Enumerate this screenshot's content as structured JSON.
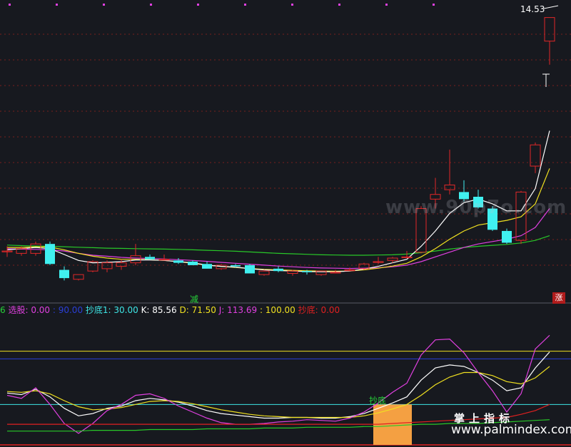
{
  "header": {
    "price_label": "14.53",
    "indicator_items": [
      {
        "text": "6",
        "color": "#27d23a"
      },
      {
        "text": " 选股: 0.00",
        "color": "#e040e0"
      },
      {
        "text": " : 90.00",
        "color": "#2a3fd8"
      },
      {
        "text": " 抄底1: 30.00",
        "color": "#3ee6e6"
      },
      {
        "text": " K: 85.56",
        "color": "#ffffff"
      },
      {
        "text": " D: 71.50",
        "color": "#f0e020"
      },
      {
        "text": " J: 113.69",
        "color": "#e040e0"
      },
      {
        "text": " : 100.00",
        "color": "#f0e020"
      },
      {
        "text": " 抄底: 0.00",
        "color": "#e02020"
      }
    ]
  },
  "annotations": {
    "sell_marker": "减",
    "limit_up_marker": "涨",
    "bottom_marker": "抄底"
  },
  "watermark": {
    "main": "www.90p7o.com",
    "cn": "掌上指标",
    "en": "www.palmindex.com"
  },
  "colors": {
    "background": "#17191f",
    "up_candle": "#e02828",
    "down_candle": "#40f0f0",
    "ma_white": "#ffffff",
    "ma_yellow": "#f0e020",
    "ma_magenta": "#e040e0",
    "ma_green": "#28c828",
    "grid": "#7a1e1e"
  },
  "chart_data": [
    {
      "type": "candlestick",
      "title": "",
      "ylim": [
        3.5,
        15.2
      ],
      "candles": [
        {
          "o": 5.1,
          "h": 5.3,
          "l": 4.85,
          "c": 5.1
        },
        {
          "o": 5.0,
          "h": 5.3,
          "l": 4.9,
          "c": 5.2
        },
        {
          "o": 5.0,
          "h": 5.5,
          "l": 4.9,
          "c": 5.4
        },
        {
          "o": 5.4,
          "h": 5.5,
          "l": 4.5,
          "c": 4.55
        },
        {
          "o": 4.3,
          "h": 4.45,
          "l": 3.85,
          "c": 3.95
        },
        {
          "o": 3.9,
          "h": 4.1,
          "l": 3.85,
          "c": 4.1
        },
        {
          "o": 4.25,
          "h": 4.7,
          "l": 4.2,
          "c": 4.65
        },
        {
          "o": 4.35,
          "h": 4.7,
          "l": 4.2,
          "c": 4.6
        },
        {
          "o": 4.45,
          "h": 4.75,
          "l": 4.3,
          "c": 4.6
        },
        {
          "o": 4.6,
          "h": 5.4,
          "l": 4.5,
          "c": 4.9
        },
        {
          "o": 4.85,
          "h": 4.95,
          "l": 4.75,
          "c": 4.75
        },
        {
          "o": 4.75,
          "h": 4.95,
          "l": 4.7,
          "c": 4.75
        },
        {
          "o": 4.7,
          "h": 4.8,
          "l": 4.55,
          "c": 4.6
        },
        {
          "o": 4.65,
          "h": 4.7,
          "l": 4.5,
          "c": 4.5
        },
        {
          "o": 4.55,
          "h": 4.65,
          "l": 4.35,
          "c": 4.35
        },
        {
          "o": 4.35,
          "h": 4.55,
          "l": 4.3,
          "c": 4.5
        },
        {
          "o": 4.5,
          "h": 4.55,
          "l": 4.4,
          "c": 4.45
        },
        {
          "o": 4.5,
          "h": 4.55,
          "l": 4.15,
          "c": 4.15
        },
        {
          "o": 4.1,
          "h": 4.3,
          "l": 4.05,
          "c": 4.25
        },
        {
          "o": 4.35,
          "h": 4.45,
          "l": 4.2,
          "c": 4.25
        },
        {
          "o": 4.15,
          "h": 4.3,
          "l": 4.05,
          "c": 4.25
        },
        {
          "o": 4.25,
          "h": 4.3,
          "l": 4.1,
          "c": 4.2
        },
        {
          "o": 4.1,
          "h": 4.25,
          "l": 4.05,
          "c": 4.25
        },
        {
          "o": 4.2,
          "h": 4.3,
          "l": 4.15,
          "c": 4.2
        },
        {
          "o": 4.3,
          "h": 4.4,
          "l": 4.25,
          "c": 4.3
        },
        {
          "o": 4.35,
          "h": 4.6,
          "l": 4.3,
          "c": 4.55
        },
        {
          "o": 4.65,
          "h": 4.85,
          "l": 4.55,
          "c": 4.65
        },
        {
          "o": 4.7,
          "h": 4.85,
          "l": 4.6,
          "c": 4.8
        },
        {
          "o": 4.85,
          "h": 5.1,
          "l": 4.8,
          "c": 4.85
        },
        {
          "o": 5.05,
          "h": 7.0,
          "l": 5.0,
          "c": 6.9
        },
        {
          "o": 7.3,
          "h": 8.2,
          "l": 6.9,
          "c": 7.5
        },
        {
          "o": 7.7,
          "h": 9.4,
          "l": 7.5,
          "c": 7.9
        },
        {
          "o": 7.6,
          "h": 8.1,
          "l": 7.2,
          "c": 7.3
        },
        {
          "o": 7.4,
          "h": 7.7,
          "l": 6.9,
          "c": 6.95
        },
        {
          "o": 6.9,
          "h": 7.0,
          "l": 5.95,
          "c": 6.0
        },
        {
          "o": 5.95,
          "h": 6.05,
          "l": 5.4,
          "c": 5.45
        },
        {
          "o": 5.55,
          "h": 7.65,
          "l": 5.4,
          "c": 7.6
        },
        {
          "o": 8.7,
          "h": 9.7,
          "l": 8.4,
          "c": 9.6
        },
        {
          "o": 14.0,
          "h": 15.0,
          "l": 13.0,
          "c": 15.0
        }
      ],
      "ma_white": [
        5.15,
        5.2,
        5.25,
        5.2,
        4.95,
        4.7,
        4.6,
        4.62,
        4.65,
        4.72,
        4.72,
        4.7,
        4.65,
        4.6,
        4.5,
        4.45,
        4.42,
        4.35,
        4.3,
        4.27,
        4.25,
        4.23,
        4.22,
        4.22,
        4.25,
        4.33,
        4.45,
        4.6,
        4.75,
        5.3,
        5.95,
        6.7,
        7.15,
        7.3,
        7.1,
        6.8,
        6.8,
        7.75,
        10.2
      ],
      "ma_yellow": [
        5.25,
        5.25,
        5.28,
        5.27,
        5.15,
        5.0,
        4.88,
        4.8,
        4.75,
        4.75,
        4.73,
        4.7,
        4.65,
        4.58,
        4.5,
        4.45,
        4.4,
        4.36,
        4.32,
        4.3,
        4.28,
        4.26,
        4.25,
        4.24,
        4.25,
        4.3,
        4.37,
        4.46,
        4.58,
        4.85,
        5.2,
        5.6,
        5.95,
        6.2,
        6.3,
        6.4,
        6.55,
        7.1,
        8.6
      ],
      "ma_magenta": [
        5.2,
        5.18,
        5.17,
        5.15,
        5.1,
        5.0,
        4.92,
        4.88,
        4.83,
        4.8,
        4.78,
        4.76,
        4.73,
        4.7,
        4.66,
        4.62,
        4.58,
        4.54,
        4.5,
        4.46,
        4.43,
        4.4,
        4.38,
        4.37,
        4.36,
        4.37,
        4.39,
        4.43,
        4.5,
        4.65,
        4.85,
        5.05,
        5.25,
        5.4,
        5.5,
        5.6,
        5.75,
        6.1,
        6.9
      ],
      "ma_green": [
        5.35,
        5.33,
        5.31,
        5.3,
        5.28,
        5.26,
        5.24,
        5.22,
        5.21,
        5.2,
        5.19,
        5.18,
        5.17,
        5.15,
        5.13,
        5.11,
        5.09,
        5.06,
        5.03,
        5.0,
        4.98,
        4.96,
        4.94,
        4.93,
        4.92,
        4.92,
        4.93,
        4.94,
        4.97,
        5.03,
        5.1,
        5.18,
        5.25,
        5.3,
        5.34,
        5.38,
        5.44,
        5.55,
        5.75
      ]
    },
    {
      "type": "line",
      "title": "",
      "ylim": [
        -25,
        140
      ],
      "series": [
        {
          "name": "K",
          "values": [
            45,
            43,
            50,
            40,
            25,
            15,
            18,
            25,
            28,
            35,
            38,
            36,
            33,
            28,
            22,
            18,
            16,
            14,
            12,
            12,
            13,
            13,
            12,
            12,
            14,
            18,
            25,
            32,
            40,
            62,
            78,
            82,
            80,
            72,
            62,
            48,
            52,
            78,
            99
          ]
        },
        {
          "name": "D",
          "values": [
            47,
            46,
            48,
            44,
            35,
            27,
            23,
            24,
            26,
            30,
            34,
            35,
            34,
            31,
            27,
            23,
            20,
            17,
            15,
            14,
            13,
            13,
            13,
            13,
            13,
            15,
            19,
            24,
            30,
            42,
            56,
            66,
            72,
            72,
            68,
            60,
            57,
            65,
            80
          ]
        },
        {
          "name": "J",
          "values": [
            42,
            38,
            52,
            30,
            5,
            -8,
            5,
            22,
            30,
            42,
            44,
            38,
            28,
            20,
            12,
            6,
            4,
            4,
            5,
            7,
            8,
            10,
            9,
            8,
            12,
            20,
            32,
            46,
            58,
            95,
            115,
            116,
            98,
            72,
            48,
            20,
            44,
            103,
            121
          ]
        },
        {
          "name": "抄底",
          "values": [
            4,
            4,
            4,
            4,
            4,
            4,
            4,
            4,
            4,
            4,
            4,
            4,
            4,
            4,
            4,
            4,
            4,
            4,
            4,
            4,
            4,
            4,
            4,
            4,
            4,
            4,
            4,
            5,
            6,
            7,
            8,
            9,
            10,
            11,
            12,
            13,
            17,
            22,
            30
          ]
        },
        {
          "name": "选股",
          "values": [
            -5,
            -5,
            -5,
            -5,
            -5,
            -5,
            -4,
            -4,
            -4,
            -4,
            -3,
            -3,
            -3,
            -3,
            -2,
            -2,
            -2,
            -2,
            -1,
            -1,
            -1,
            0,
            0,
            0,
            0,
            1,
            1,
            2,
            3,
            4,
            4,
            5,
            5,
            5,
            6,
            7,
            8,
            9,
            10
          ]
        }
      ],
      "reference_lines": [
        {
          "name": "抄底1",
          "value": 30
        },
        {
          "name": "",
          "value": 90
        },
        {
          "name": "",
          "value": 100
        }
      ],
      "signal_bars": [
        {
          "from_index": 26,
          "to_index": 28,
          "value": 30
        }
      ]
    }
  ]
}
